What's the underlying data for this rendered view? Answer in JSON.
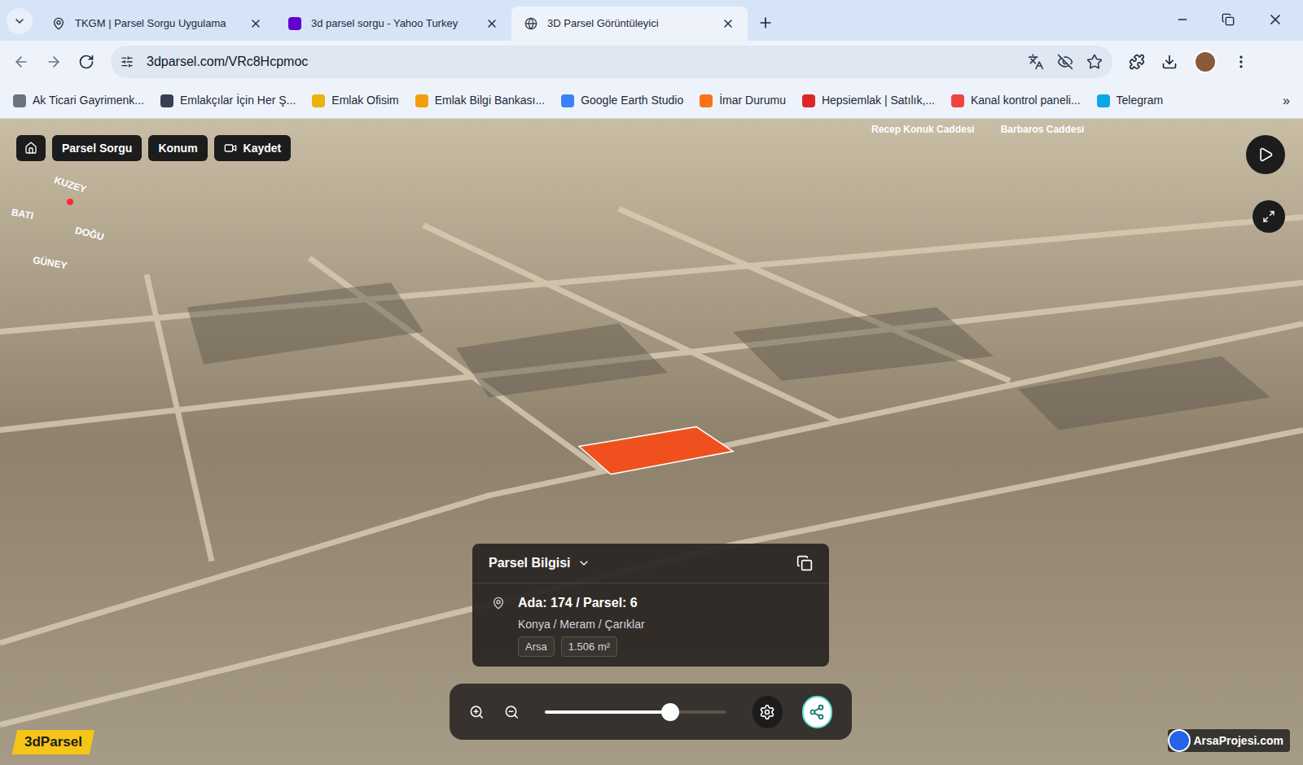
{
  "browser": {
    "tabs": [
      {
        "label": "TKGM | Parsel Sorgu Uygulama",
        "selected": false
      },
      {
        "label": "3d parsel sorgu - Yahoo Turkey",
        "selected": false
      },
      {
        "label": "3D Parsel Görüntüleyici",
        "selected": true
      }
    ],
    "address": "3dparsel.com/VRc8Hcpmoc",
    "bookmarks": [
      "Ak Ticari Gayrimenk...",
      "Emlakçılar İçin Her Ş...",
      "Emlak Ofisim",
      "Emlak Bilgi Bankası...",
      "Google Earth Studio",
      "İmar Durumu",
      "Hepsiemlak | Satılık,...",
      "Kanal kontrol paneli...",
      "Telegram"
    ],
    "bookmarks_more": "»"
  },
  "toolbar": {
    "buttons": [
      "Parsel Sorgu",
      "Konum",
      "Kaydet"
    ]
  },
  "compass": {
    "north": "KUZEY",
    "west": "BATI",
    "east": "DOĞU",
    "south": "GÜNEY"
  },
  "map": {
    "streets": [
      "Recep Konuk Caddesi",
      "Barbaros Caddesi"
    ]
  },
  "parcel_info": {
    "title": "Parsel Bilgisi",
    "ada_parsel": "Ada: 174 / Parsel: 6",
    "location": "Konya / Meram / Çarıklar",
    "type": "Arsa",
    "area": "1.506 m²"
  },
  "zoom": {
    "level": 0.69
  },
  "branding": {
    "logo": "3dParsel",
    "watermark": "ArsaProjesi.com"
  }
}
